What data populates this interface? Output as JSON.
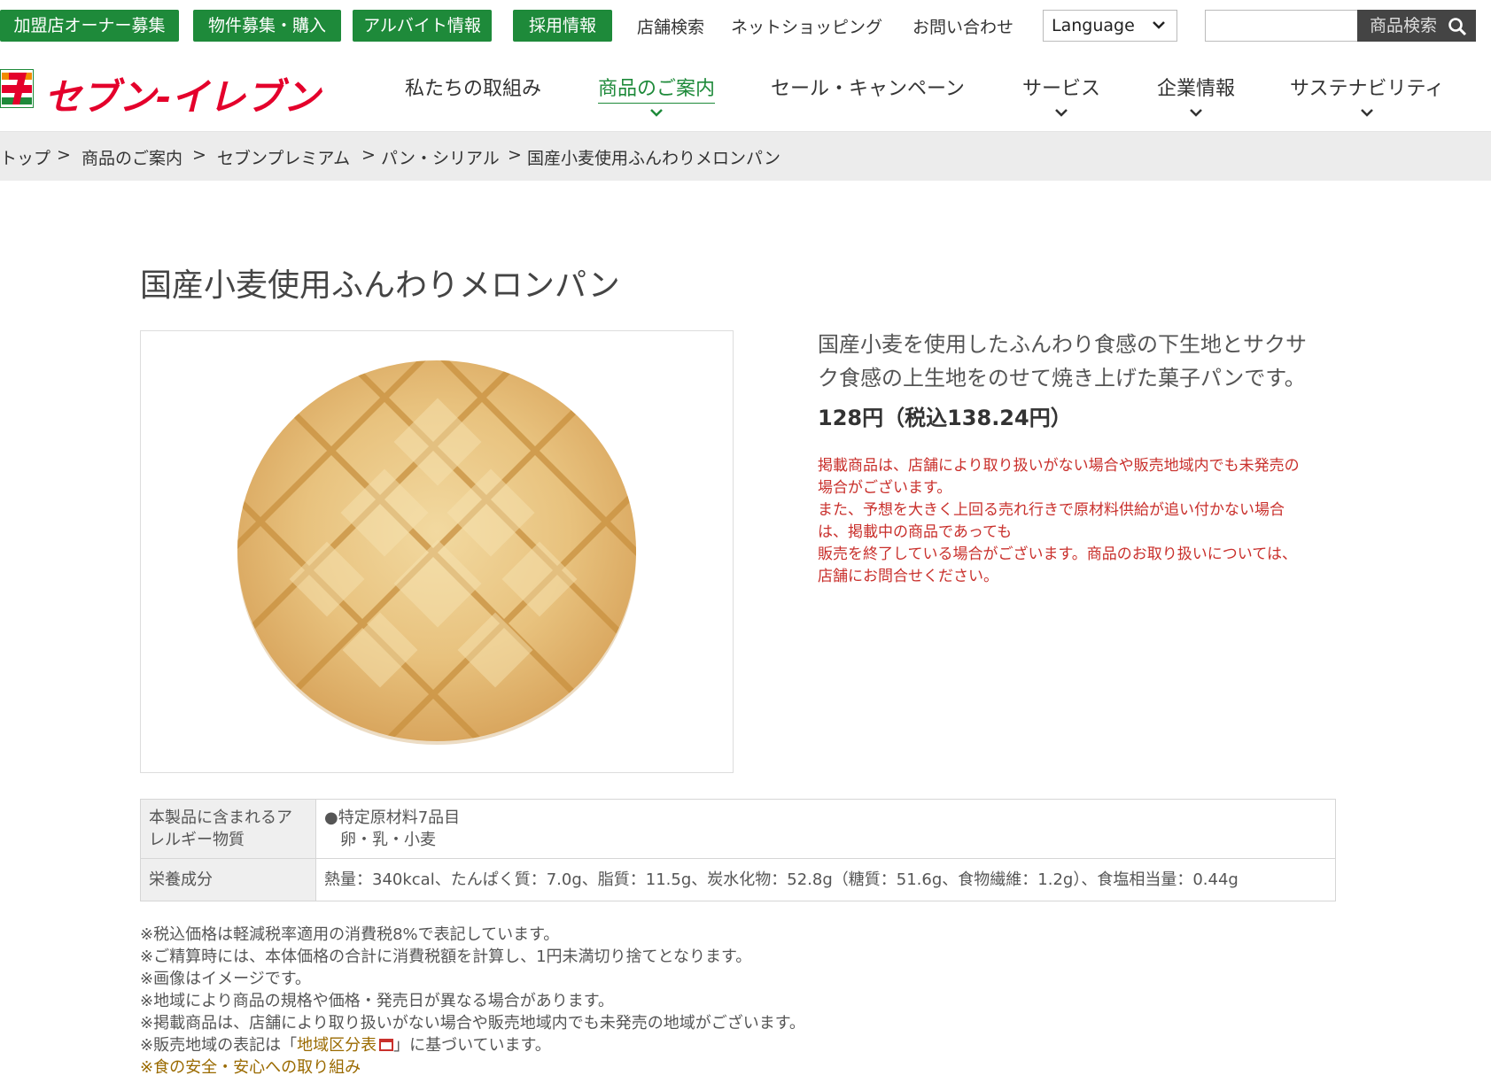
{
  "topbar": {
    "green_buttons": [
      "加盟店オーナー募集",
      "物件募集・購入",
      "アルバイト情報",
      "採用情報"
    ],
    "links": [
      "店舗検索",
      "ネットショッピング",
      "お問い合わせ"
    ],
    "language_label": "Language",
    "search_placeholder": "",
    "search_button": "商品検索"
  },
  "header": {
    "logo_text": "セブン-イレブン",
    "nav": [
      {
        "label": "私たちの取組み"
      },
      {
        "label": "商品のご案内"
      },
      {
        "label": "セール・キャンペーン"
      },
      {
        "label": "サービス"
      },
      {
        "label": "企業情報"
      },
      {
        "label": "サステナビリティ"
      }
    ],
    "accent": "#1e8a3a",
    "brand_red": "#e4002b"
  },
  "breadcrumb": [
    "トップ",
    "商品のご案内",
    "セブンプレミアム",
    "パン・シリアル",
    "国産小麦使用ふんわりメロンパン"
  ],
  "breadcrumb_separator": ">",
  "product": {
    "title": "国産小麦使用ふんわりメロンパン",
    "description_lines": [
      "国産小麦を使用したふんわり食感の下生地とサクサ",
      "ク食感の上生地をのせて焼き上げた菓子パンです。"
    ],
    "price": "128円（税込138.24円）",
    "notice_lines": [
      "掲載商品は、店舗により取り扱いがない場合や販売地域内でも未発売の",
      "場合がございます。",
      "また、予想を大きく上回る売れ行きで原材料供給が追い付かない場合",
      "は、掲載中の商品であっても",
      "販売を終了している場合がございます。商品のお取り扱いについては、",
      "店舗にお問合せください。"
    ]
  },
  "info_table": {
    "allergy_header_lines": [
      "本製品に含まれるア",
      "レルギー物質"
    ],
    "allergy_value_lines": [
      "●特定原材料7品目",
      "　卵・乳・小麦"
    ],
    "nutrition_header": "栄養成分",
    "nutrition_value": "熱量：340kcal、たんぱく質：7.0g、脂質：11.5g、炭水化物：52.8g（糖質：51.6g、食物繊維：1.2g）、食塩相当量：0.44g"
  },
  "notes": {
    "lines": [
      "※税込価格は軽減税率適用の消費税8%で表記しています。",
      "※ご精算時には、本体価格の合計に消費税額を計算し、1円未満切り捨てとなります。",
      "※画像はイメージです。",
      "※地域により商品の規格や価格・発売日が異なる場合があります。",
      "※掲載商品は、店舗により取り扱いがない場合や販売地域内でも未発売の地域がございます。"
    ],
    "region_prefix": "※販売地域の表記は「",
    "region_link": "地域区分表",
    "region_suffix": "」に基づいています。",
    "safety_prefix": "※",
    "safety_link": "食の安全・安心への取り組み"
  }
}
